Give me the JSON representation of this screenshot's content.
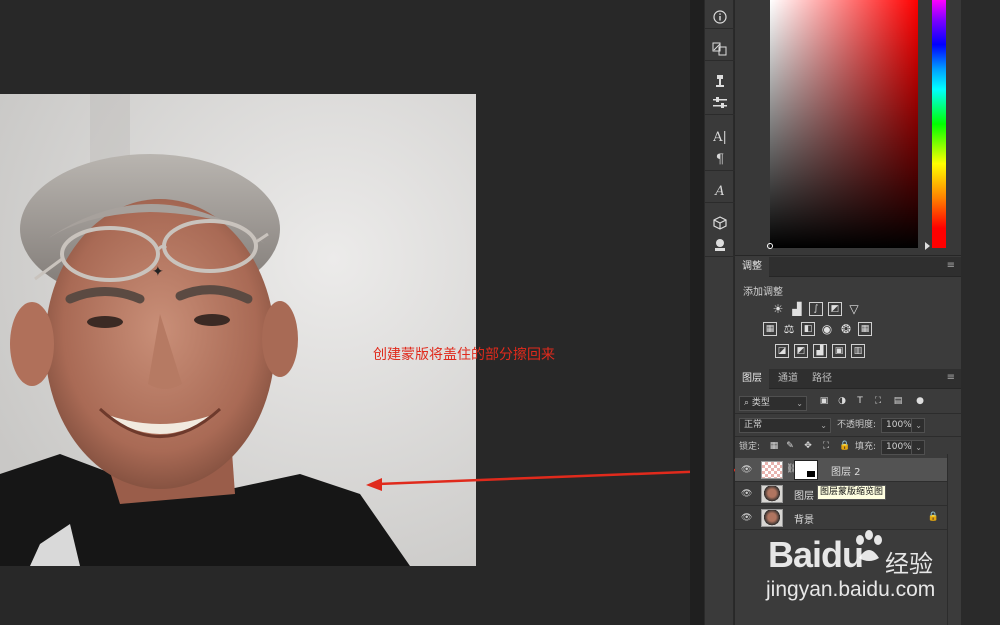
{
  "annotation": "创建蒙版将盖住的部分擦回来",
  "adjustments": {
    "tab": "调整",
    "add_label": "添加调整"
  },
  "layers_panel": {
    "tabs": [
      "图层",
      "通道",
      "路径"
    ],
    "filter_value": "类型",
    "blend_mode": "正常",
    "opacity_label": "不透明度:",
    "opacity_value": "100%",
    "lock_label": "锁定:",
    "fill_label": "填充:",
    "fill_value": "100%",
    "layers": [
      {
        "name": "图层 2",
        "selected": true,
        "has_mask": true
      },
      {
        "name": "图层",
        "selected": false,
        "tooltip": "图层蒙版缩览图"
      },
      {
        "name": "背景",
        "selected": false,
        "locked": true
      }
    ]
  },
  "toolbar_icons": [
    "info-icon",
    "brush-presets-icon",
    "clone-source-icon",
    "properties-icon",
    "character-icon",
    "paragraph-icon",
    "glyphs-icon",
    "3d-icon",
    "materials-icon"
  ],
  "watermark": {
    "brand": "Baidu",
    "cn": "经验",
    "url": "jingyan.baidu.com"
  },
  "colors": {
    "accent_red": "#e02a1c",
    "panel_bg": "#3b3b3b",
    "canvas_bg": "#282828"
  }
}
